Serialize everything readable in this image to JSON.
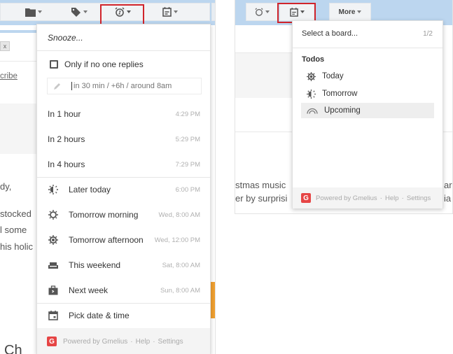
{
  "left": {
    "toolbar": {
      "buttons": [
        {
          "name": "move-to",
          "icon": "folder-icon"
        },
        {
          "name": "labels",
          "icon": "tag-icon"
        },
        {
          "name": "snooze",
          "icon": "alarm-clock-icon",
          "highlighted": true
        },
        {
          "name": "boards",
          "icon": "calendar-board-icon"
        }
      ]
    },
    "background": {
      "chip_x": "x",
      "unsubscribe_fragment": "cribe",
      "text_lines": [
        "dy,",
        "stocked",
        "l some",
        "his holic"
      ],
      "bottom_fragment": "Ch"
    },
    "snooze_menu": {
      "title": "Snooze...",
      "only_if_no_reply": {
        "label": "Only if no one replies",
        "checked": false
      },
      "input": {
        "value": "",
        "placeholder": "in 30 min / +6h / around 8am"
      },
      "quick_options": [
        {
          "label": "In 1 hour",
          "time": "4:29 PM"
        },
        {
          "label": "In 2 hours",
          "time": "5:29 PM"
        },
        {
          "label": "In 4 hours",
          "time": "7:29 PM"
        }
      ],
      "scheduled_options": [
        {
          "label": "Later today",
          "time": "6:00 PM",
          "icon": "half-sun-icon"
        },
        {
          "label": "Tomorrow morning",
          "time": "Wed, 8:00 AM",
          "icon": "sunrise-icon"
        },
        {
          "label": "Tomorrow afternoon",
          "time": "Wed, 12:00 PM",
          "icon": "sun-icon"
        },
        {
          "label": "This weekend",
          "time": "Sat, 8:00 AM",
          "icon": "couch-icon"
        },
        {
          "label": "Next week",
          "time": "Sun, 8:00 AM",
          "icon": "briefcase-icon"
        }
      ],
      "pick_date": {
        "label": "Pick date & time",
        "icon": "calendar-icon"
      },
      "footer": {
        "logo": "G",
        "powered": "Powered by Gmelius",
        "sep": "·",
        "help": "Help",
        "settings": "Settings"
      }
    }
  },
  "right": {
    "toolbar": {
      "more_label": "More"
    },
    "background": {
      "text_lines": [
        "stmas music",
        "er by surprisi"
      ],
      "right_fragments": [
        "ar",
        "ia"
      ]
    },
    "board_menu": {
      "title": "Select a board...",
      "page": "1/2",
      "section": "Todos",
      "items": [
        {
          "label": "Today",
          "icon": "sun-icon",
          "selected": false
        },
        {
          "label": "Tomorrow",
          "icon": "half-sun-icon",
          "selected": false
        },
        {
          "label": "Upcoming",
          "icon": "rainbow-icon",
          "selected": true
        }
      ],
      "footer": {
        "logo": "G",
        "powered": "Powered by Gmelius",
        "sep": "·",
        "help": "Help",
        "settings": "Settings"
      }
    }
  },
  "colors": {
    "toolbar_bg": "#bcd6ef",
    "highlight": "#d0242b",
    "gmelius_red": "#e64545",
    "accent_orange": "#f0a030"
  }
}
